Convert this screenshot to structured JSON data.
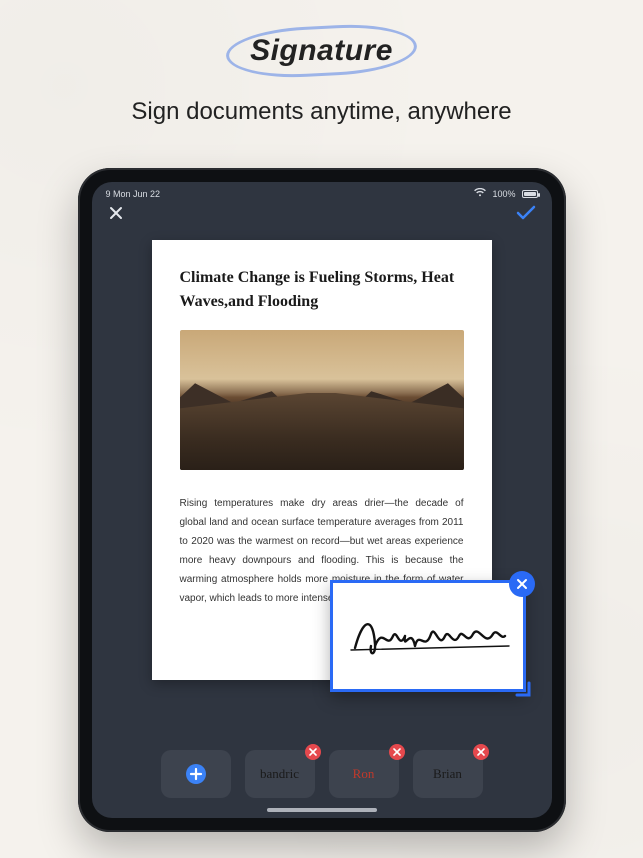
{
  "hero": {
    "brand": "Signature",
    "tagline": "Sign documents anytime, anywhere"
  },
  "statusbar": {
    "time": "9 Mon Jun 22",
    "battery": "100%"
  },
  "document": {
    "title": "Climate Change is Fueling Storms, Heat Waves,and Flooding",
    "body": "Rising temperatures make dry areas drier—the decade of global land and ocean surface temperature averages from 2011 to 2020 was the warmest on record—but wet areas experience more heavy downpours and flooding. This is because the warming atmosphere holds more moisture in the form of water vapor, which leads to more intense rainfall."
  },
  "signature_overlay": {
    "icons": {
      "close": "close-icon",
      "resize": "resize-handle-icon"
    }
  },
  "tray": {
    "add_icon": "plus-icon",
    "items": [
      {
        "label": "bandric",
        "color": "#1a1a1a"
      },
      {
        "label": "Ron",
        "color": "#c0392b"
      },
      {
        "label": "Brian",
        "color": "#1a1a1a"
      }
    ],
    "delete_icon": "close-icon"
  },
  "topbar": {
    "close_icon": "close-icon",
    "confirm_icon": "check-icon"
  }
}
